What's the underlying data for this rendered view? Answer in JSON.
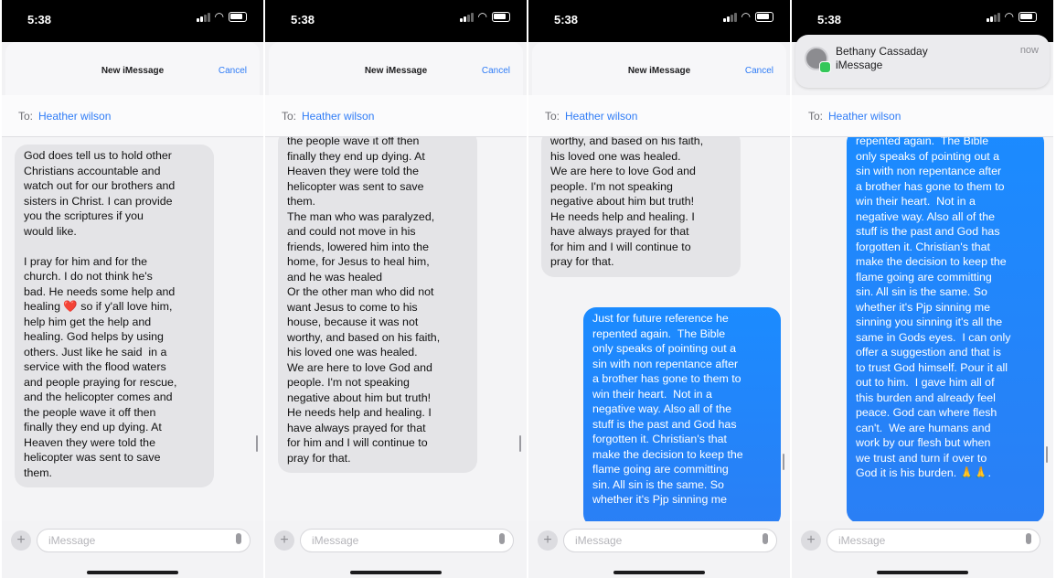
{
  "status": {
    "time": "5:38"
  },
  "compose_header": {
    "title": "New iMessage",
    "cancel_label": "Cancel"
  },
  "notification": {
    "sender": "Bethany Cassaday",
    "app": "iMessage",
    "time": "now"
  },
  "to": {
    "label": "To:",
    "recipient": "Heather wilson"
  },
  "input": {
    "placeholder": "iMessage"
  },
  "colors": {
    "accent": "#2f7cf6",
    "outgoing_bubble": "#1b8bff",
    "incoming_bubble": "#e4e4e7"
  },
  "icons": [
    "signal-icon",
    "wifi-icon",
    "battery-icon",
    "plus-icon",
    "mic-icon"
  ],
  "messages": {
    "p1_in": "God does tell us to hold other\nChristians accountable and\nwatch out for our brothers and\nsisters in Christ. I can provide\nyou the scriptures if you\nwould like.\n\nI pray for him and for the\nchurch. I do not think he's\nbad. He needs some help and\nhealing ❤️ so if y'all love him,\nhelp him get the help and\nhealing. God helps by using\nothers. Just like he said  in a\nservice with the flood waters\nand people praying for rescue,\nand the helicopter comes and\nthe people wave it off then\nfinally they end up dying. At\nHeaven they were told the\nhelicopter was sent to save\nthem.",
    "p2_in": "the people wave it off then\nfinally they end up dying. At\nHeaven they were told the\nhelicopter was sent to save\nthem.\nThe man who was paralyzed,\nand could not move in his\nfriends, lowered him into the\nhome, for Jesus to heal him,\nand he was healed\nOr the other man who did not\nwant Jesus to come to his\nhouse, because it was not\nworthy, and based on his faith,\nhis loved one was healed.\nWe are here to love God and\npeople. I'm not speaking\nnegative about him but truth!\nHe needs help and healing. I\nhave always prayed for that\nfor him and I will continue to\npray for that.",
    "p3_in": "worthy, and based on his faith,\nhis loved one was healed.\nWe are here to love God and\npeople. I'm not speaking\nnegative about him but truth!\nHe needs help and healing. I\nhave always prayed for that\nfor him and I will continue to\npray for that.",
    "p3_out": "Just for future reference he\nrepented again.  The Bible\nonly speaks of pointing out a\nsin with non repentance after\na brother has gone to them to\nwin their heart.  Not in a\nnegative way. Also all of the\nstuff is the past and God has\nforgotten it. Christian's that\nmake the decision to keep the\nflame going are committing\nsin. All sin is the same. So\nwhether it's Pjp sinning me",
    "p4_out": "repented again.  The Bible\nonly speaks of pointing out a\nsin with non repentance after\na brother has gone to them to\nwin their heart.  Not in a\nnegative way. Also all of the\nstuff is the past and God has\nforgotten it. Christian's that\nmake the decision to keep the\nflame going are committing\nsin. All sin is the same. So\nwhether it's Pjp sinning me\nsinning you sinning it's all the\nsame in Gods eyes.  I can only\noffer a suggestion and that is\nto trust God himself. Pour it all\nout to him.  I gave him all of\nthis burden and already feel\npeace. God can where flesh\ncan't.  We are humans and\nwork by our flesh but when\nwe trust and turn if over to\nGod it is his burden. 🙏🙏."
  }
}
